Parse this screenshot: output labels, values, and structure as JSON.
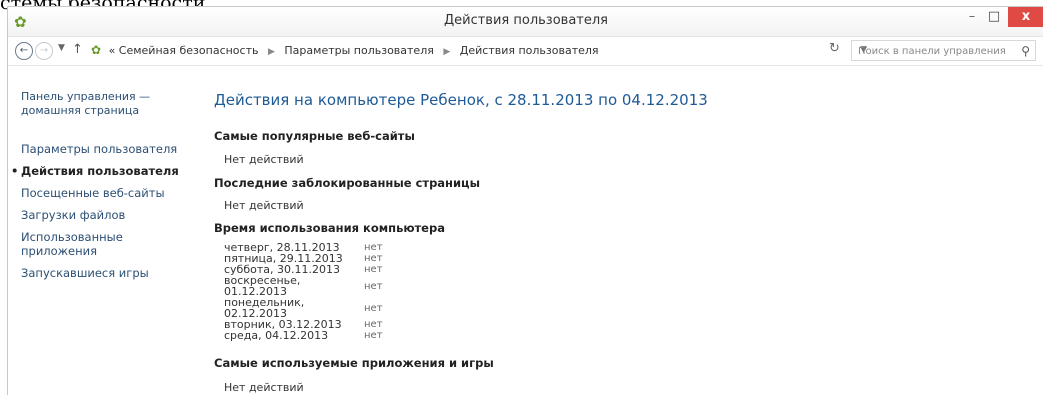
{
  "above_text": "стемы безопасности.",
  "window": {
    "title": "Действия пользователя",
    "icon": "control-panel-icon",
    "controls": {
      "minimize": "–",
      "maximize": "□",
      "close": "x"
    }
  },
  "nav": {
    "back": "←",
    "forward": "→",
    "up": "↑",
    "breadcrumb": [
      "Семейная безопасность",
      "Параметры пользователя",
      "Действия пользователя"
    ],
    "breadcrumb_prefix": "«",
    "search_placeholder": "Поиск в панели управления"
  },
  "sidebar": {
    "home": "Панель управления — домашняя страница",
    "items": [
      {
        "label": "Параметры пользователя",
        "active": false
      },
      {
        "label": "Действия пользователя",
        "active": true
      },
      {
        "label": "Посещенные веб-сайты",
        "active": false
      },
      {
        "label": "Загрузки файлов",
        "active": false
      },
      {
        "label": "Использованные приложения",
        "active": false
      },
      {
        "label": "Запускавшиеся игры",
        "active": false
      }
    ]
  },
  "main": {
    "title": "Действия на компьютере Ребенок, с 28.11.2013 по 04.12.2013",
    "sections": {
      "popular_sites": {
        "title": "Самые популярные веб-сайты",
        "body": "Нет действий"
      },
      "blocked_pages": {
        "title": "Последние заблокированные страницы",
        "body": "Нет действий"
      },
      "usage_time": {
        "title": "Время использования компьютера"
      },
      "apps_games": {
        "title": "Самые используемые приложения и игры",
        "body": "Нет действий"
      }
    },
    "usage_rows": [
      {
        "date": "четверг, 28.11.2013",
        "value": "нет"
      },
      {
        "date": "пятница, 29.11.2013",
        "value": "нет"
      },
      {
        "date": "суббота, 30.11.2013",
        "value": "нет"
      },
      {
        "date": "воскресенье, 01.12.2013",
        "value": "нет"
      },
      {
        "date": "понедельник, 02.12.2013",
        "value": "нет"
      },
      {
        "date": "вторник, 03.12.2013",
        "value": "нет"
      },
      {
        "date": "среда, 04.12.2013",
        "value": "нет"
      }
    ]
  }
}
